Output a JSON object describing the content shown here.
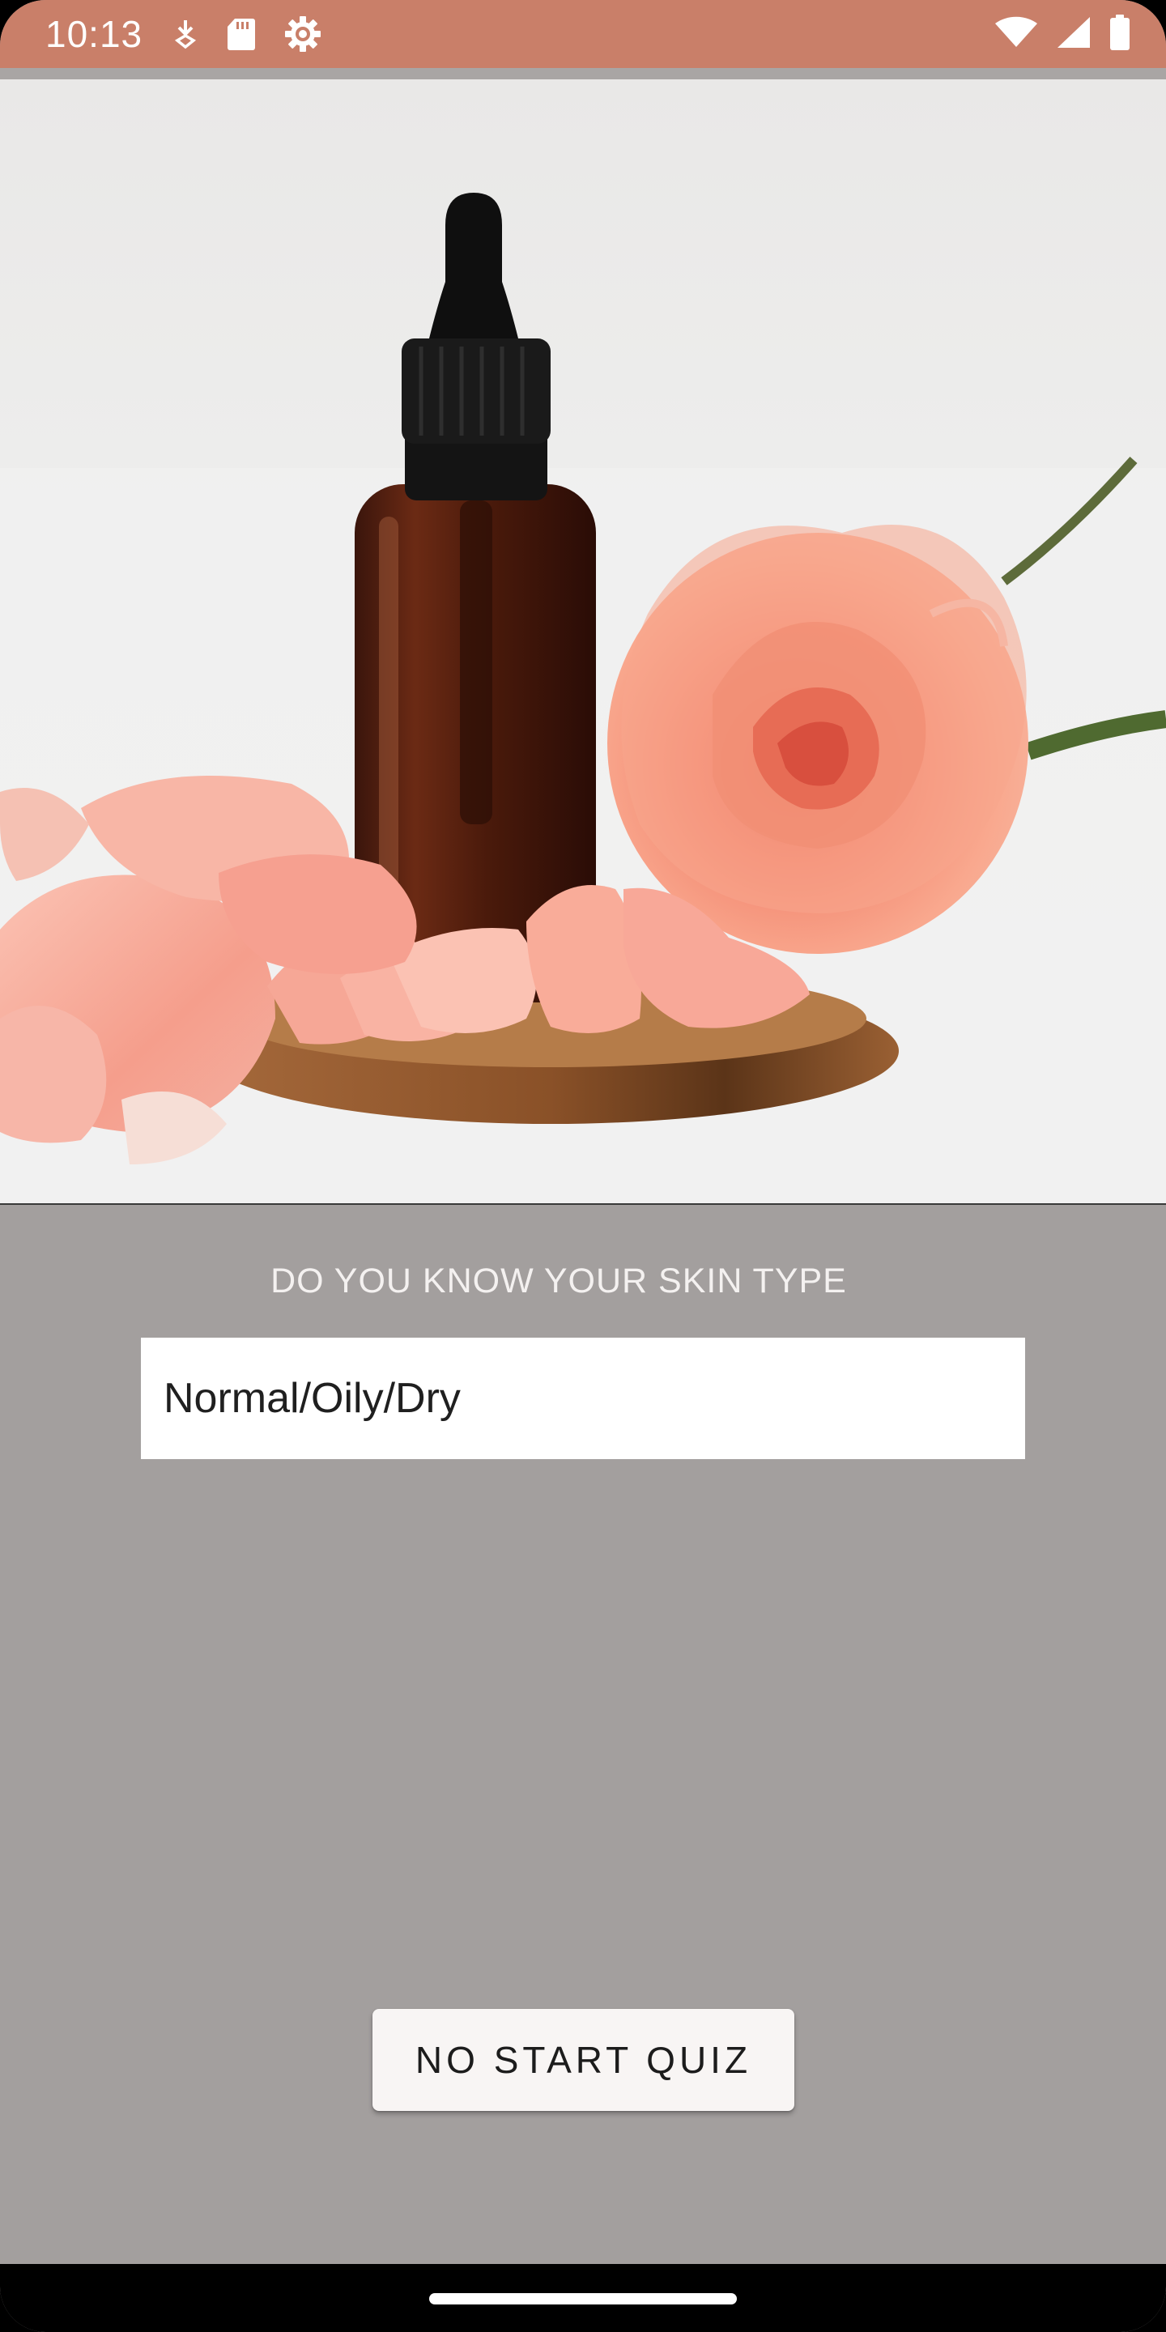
{
  "status_bar": {
    "time": "10:13",
    "left_icons": [
      "download-icon",
      "sd-card-icon",
      "settings-gear-icon"
    ],
    "right_icons": [
      "wifi-icon",
      "cell-signal-icon",
      "battery-icon"
    ],
    "color": "#c97f69"
  },
  "hero": {
    "icon": "skincare-photo-serum-bottle-and-rose"
  },
  "quiz": {
    "question": "DO YOU KNOW YOUR SKIN TYPE",
    "input_placeholder": "Normal/Oily/Dry",
    "start_button_label": "NO START QUIZ"
  },
  "colors": {
    "background": "#a39f9e",
    "input_background": "#ffffff",
    "button_background": "#f8f5f4"
  }
}
